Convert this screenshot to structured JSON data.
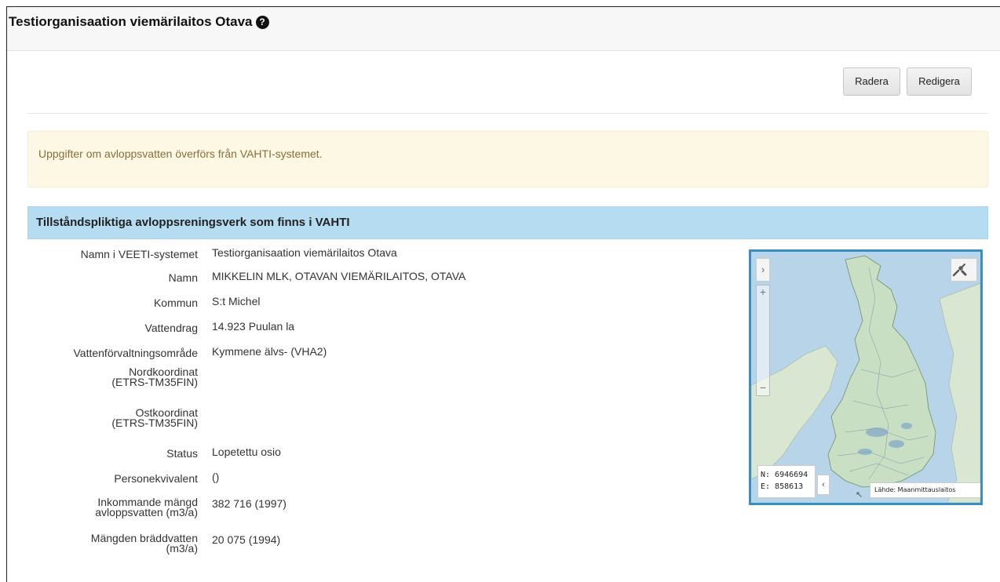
{
  "header": {
    "title": "Testiorganisaation viemärilaitos Otava",
    "help_icon": "?"
  },
  "toolbar": {
    "delete_label": "Radera",
    "edit_label": "Redigera"
  },
  "alert": {
    "text": "Uppgifter om avloppsvatten överförs från VAHTI-systemet."
  },
  "panel": {
    "heading": "Tillståndspliktiga avloppsreningsverk som finns i VAHTI",
    "rows": [
      {
        "label": "Namn i VEETI-systemet",
        "value": "Testiorganisaation viemärilaitos Otava"
      },
      {
        "label": "Namn",
        "value": "MIKKELIN MLK, OTAVAN VIEMÄRILAITOS, OTAVA"
      },
      {
        "label": "Kommun",
        "value": "S:t Michel"
      },
      {
        "label": "Vattendrag",
        "value": "14.923 Puulan la"
      },
      {
        "label": "Vattenförvaltningsområde",
        "value": "Kymmene älvs- (VHA2)"
      },
      {
        "label": "Nordkoordinat (ETRS-TM35FIN)",
        "value": ""
      },
      {
        "label": "Ostkoordinat (ETRS-TM35FIN)",
        "value": ""
      },
      {
        "label": "Status",
        "value": "Lopetettu osio"
      },
      {
        "label": "Personekvivalent",
        "value": "()"
      },
      {
        "label": "Inkommande mängd avloppsvatten (m3/a)",
        "value": "382 716 (1997)"
      },
      {
        "label": "Mängden bräddvatten (m3/a)",
        "value": "20 075 (1994)"
      }
    ]
  },
  "map": {
    "expand_icon": "›",
    "tools_icon": "wrench-screwdriver-icon",
    "zoom_in": "+",
    "zoom_out": "−",
    "coord_n": "N: 6946694",
    "coord_e": "E: 858613",
    "coord_toggle": "‹",
    "attribution": "Lähde: Maanmittauslaitos",
    "attribution_arrow": "↖",
    "colors": {
      "border": "#3a8fc2",
      "sea": "#b8d4e8",
      "land": "#c9dfc3"
    }
  }
}
